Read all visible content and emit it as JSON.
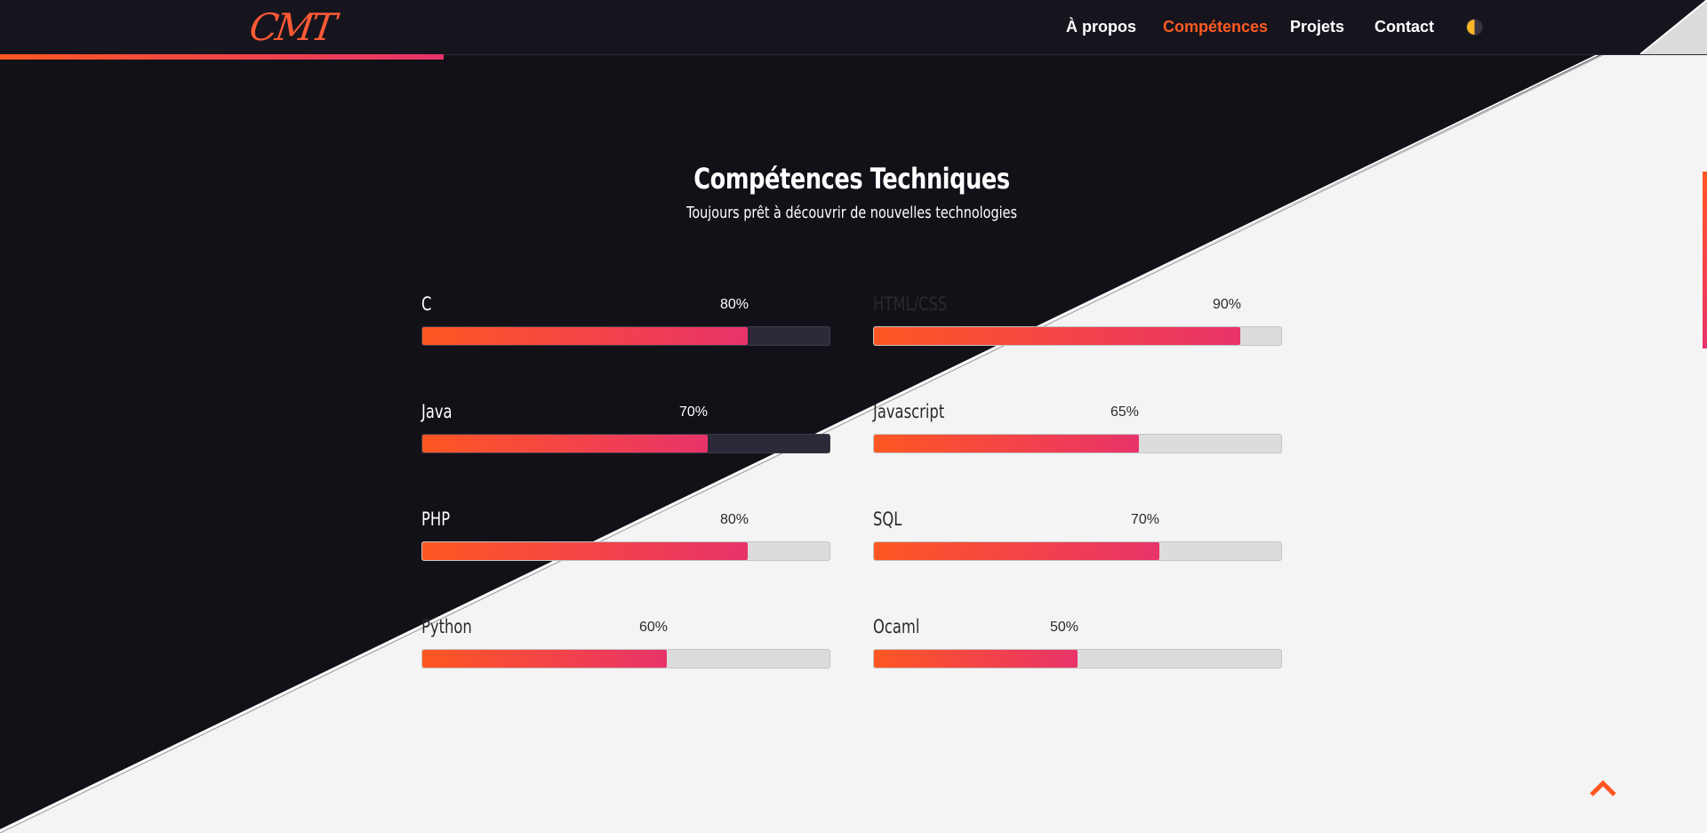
{
  "header": {
    "logo_text": "CMT",
    "nav": [
      {
        "label": "À propos",
        "active": false
      },
      {
        "label": "Compétences",
        "active": true
      },
      {
        "label": "Projets",
        "active": false
      },
      {
        "label": "Contact",
        "active": false
      }
    ],
    "theme_toggle_icon": "half-moon-toggle-icon"
  },
  "section": {
    "title": "Compétences Techniques",
    "subtitle": "Toujours prêt à découvrir de nouvelles technologies"
  },
  "skills": [
    {
      "name": "C",
      "percent_label": "80%",
      "value": 80
    },
    {
      "name": "HTML/CSS",
      "percent_label": "90%",
      "value": 90
    },
    {
      "name": "Java",
      "percent_label": "70%",
      "value": 70
    },
    {
      "name": "Javascript",
      "percent_label": "65%",
      "value": 65
    },
    {
      "name": "PHP",
      "percent_label": "80%",
      "value": 80
    },
    {
      "name": "SQL",
      "percent_label": "70%",
      "value": 70
    },
    {
      "name": "Python",
      "percent_label": "60%",
      "value": 60
    },
    {
      "name": "Ocaml",
      "percent_label": "50%",
      "value": 50
    }
  ],
  "scroll_progress": 0.26,
  "back_to_top_icon": "chevron-up-icon",
  "colors": {
    "dark_bg": "#121118",
    "light_bg": "#f4f4f4",
    "accent_start": "#ff5722",
    "accent_end": "#e8336a",
    "active_nav": "#ff5a22"
  }
}
